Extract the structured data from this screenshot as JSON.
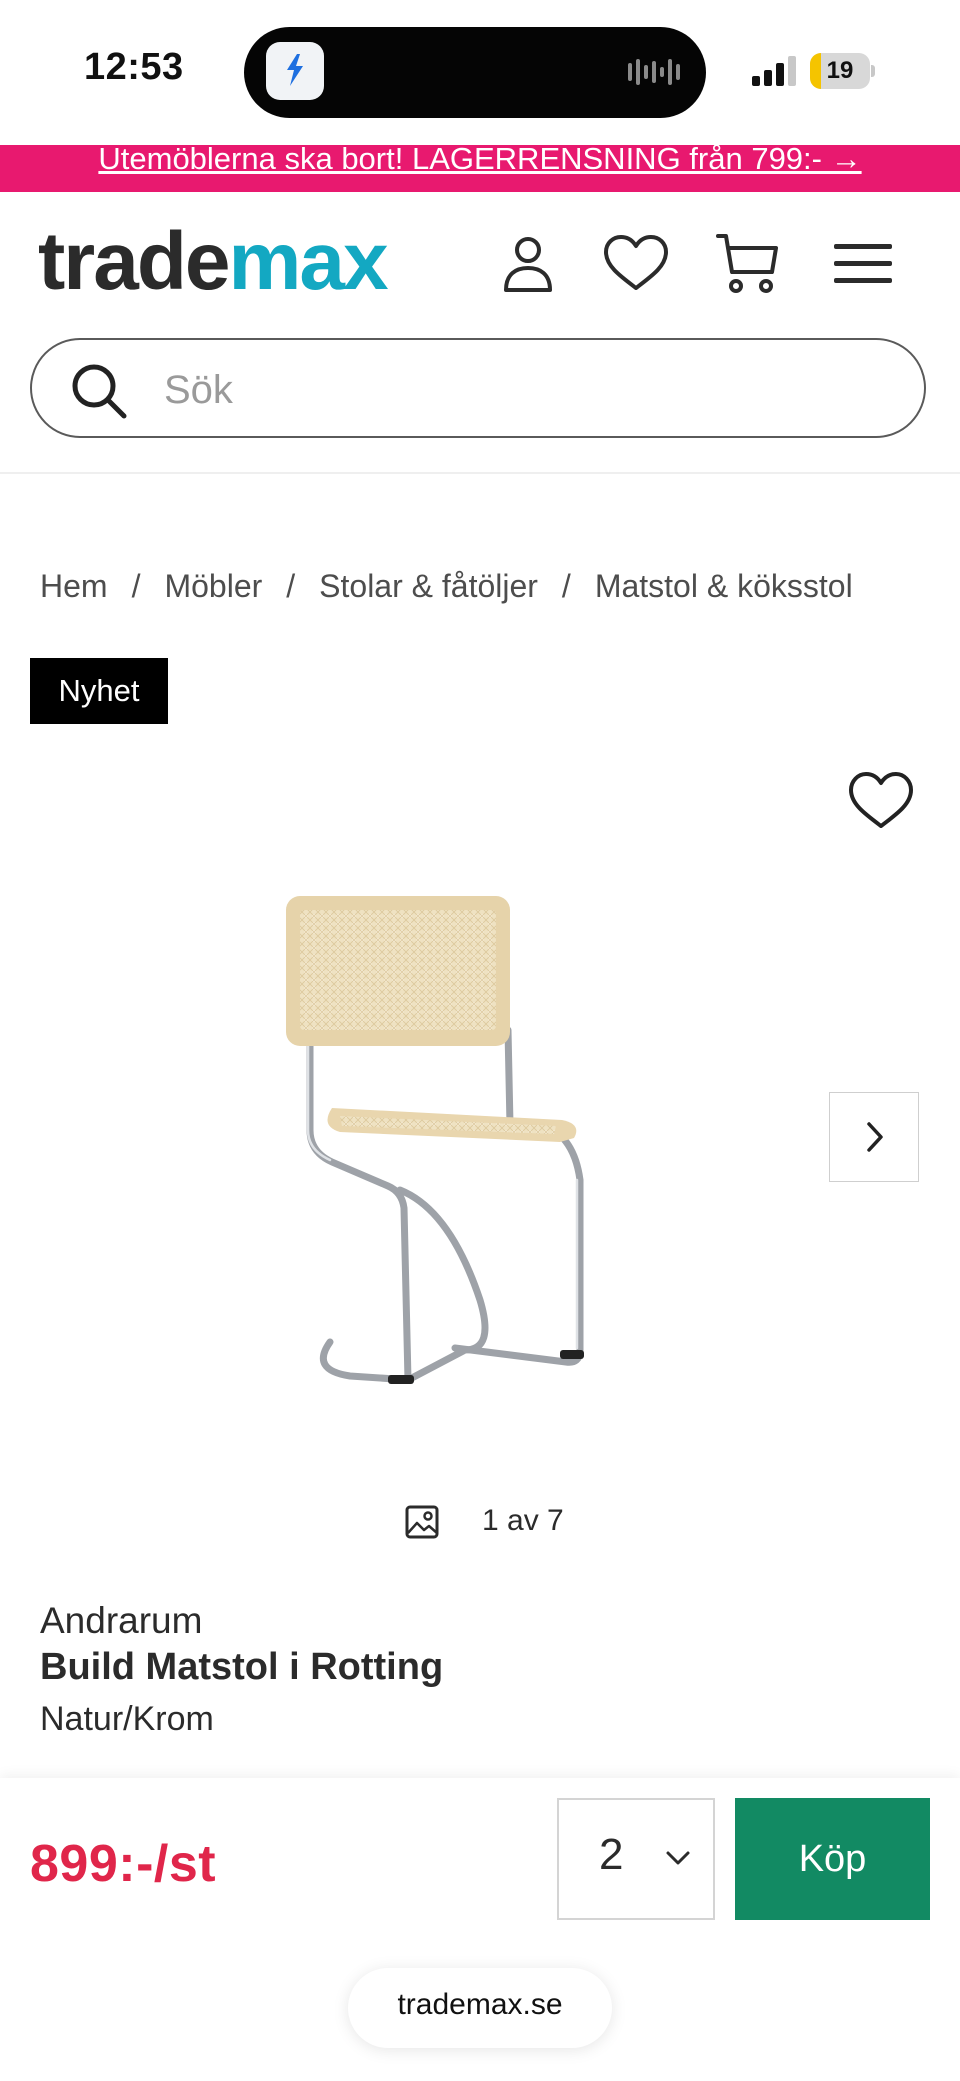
{
  "status_bar": {
    "time": "12:53",
    "battery": "19",
    "battery_level": 0.19
  },
  "promo": {
    "text": "Utemöblerna ska bort! LAGERRENSNING från 799:- →"
  },
  "header": {
    "logo_part1": "trade",
    "logo_part2": "max",
    "logo_colors": {
      "part1": "#2b2b2b",
      "part2": "#13a8c2"
    },
    "icons": [
      "user-icon",
      "heart-icon",
      "cart-icon",
      "menu-icon"
    ]
  },
  "search": {
    "placeholder": "Sök",
    "value": ""
  },
  "breadcrumb": {
    "separator": "/",
    "items": [
      "Hem",
      "Möbler",
      "Stolar & fåtöljer",
      "Matstol & köksstol"
    ]
  },
  "product": {
    "badge": "Nyhet",
    "image_counter": "1 av 7",
    "brand": "Andrarum",
    "title": "Build Matstol i Rotting",
    "variant": "Natur/Krom"
  },
  "buy_bar": {
    "price": "899:-/st",
    "quantity": "2",
    "buy_label": "Köp",
    "colors": {
      "price": "#e0264a",
      "buy_button": "#128a63"
    }
  },
  "browser": {
    "url": "trademax.se"
  },
  "colors": {
    "promo": "#e8196f"
  }
}
